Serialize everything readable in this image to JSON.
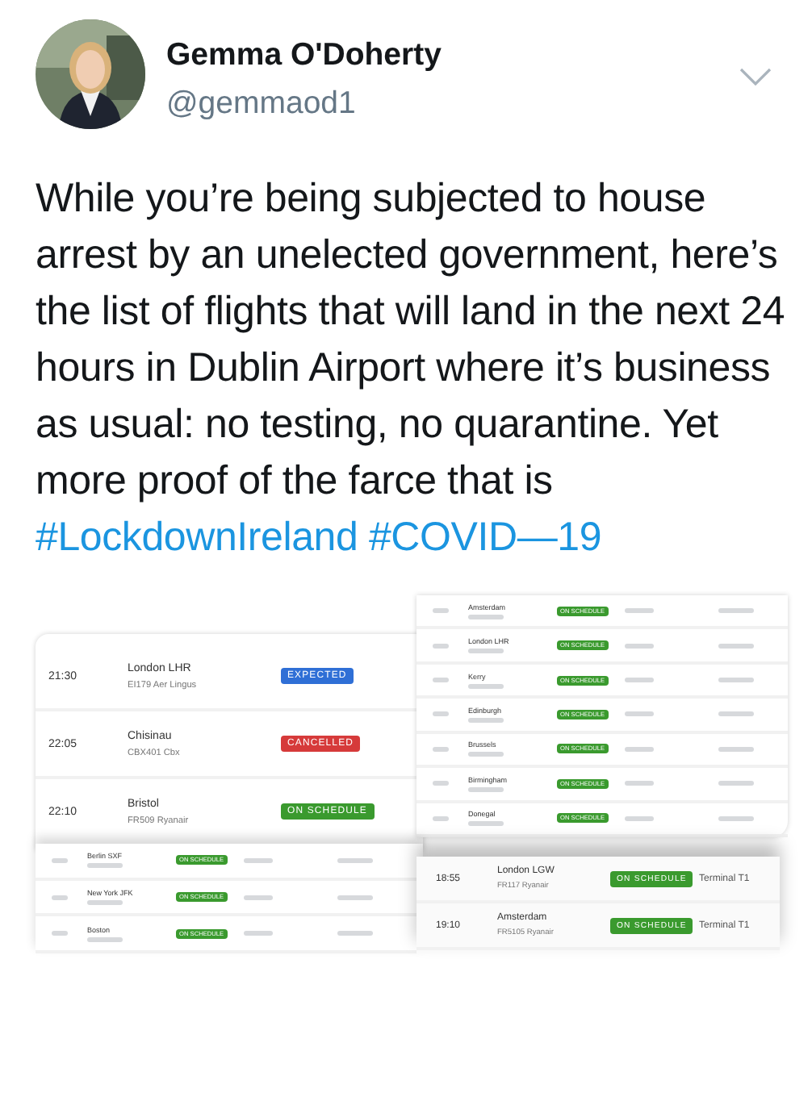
{
  "author": {
    "name": "Gemma O'Doherty",
    "handle": "@gemmaod1"
  },
  "tweet": {
    "text": "While you’re being subjected to house arrest by an unelected government, here’s the list of flights that will land in the next 24 hours in Dublin Airport where it’s business as usual:  no testing, no quarantine. Yet more proof of the farce that is ",
    "hashtags": [
      "#LockdownIreland",
      "#COVID—19"
    ]
  },
  "collage": {
    "panels": [
      {
        "kind": "large",
        "rows": [
          {
            "time": "21:30",
            "destination": "London LHR",
            "flight": "EI179 Aer Lingus",
            "status": "EXPECTED",
            "kind": "expected"
          },
          {
            "time": "22:05",
            "destination": "Chisinau",
            "flight": "CBX401 Cbx",
            "status": "CANCELLED",
            "kind": "cancelled"
          },
          {
            "time": "22:10",
            "destination": "Bristol",
            "flight": "FR509 Ryanair",
            "status": "ON SCHEDULE",
            "kind": "on_schedule"
          }
        ]
      },
      {
        "kind": "small",
        "rows": [
          {
            "destination": "Amsterdam",
            "status": "ON SCHEDULE",
            "kind": "on_schedule"
          },
          {
            "destination": "London LHR",
            "status": "ON SCHEDULE",
            "kind": "on_schedule"
          },
          {
            "destination": "Kerry",
            "status": "ON SCHEDULE",
            "kind": "on_schedule"
          },
          {
            "destination": "Edinburgh",
            "status": "ON SCHEDULE",
            "kind": "on_schedule"
          },
          {
            "destination": "Brussels",
            "status": "ON SCHEDULE",
            "kind": "on_schedule"
          },
          {
            "destination": "Birmingham",
            "status": "ON SCHEDULE",
            "kind": "on_schedule"
          },
          {
            "destination": "Donegal",
            "status": "ON SCHEDULE",
            "kind": "on_schedule"
          }
        ]
      },
      {
        "kind": "small",
        "rows": [
          {
            "destination": "Berlin SXF",
            "status": "ON SCHEDULE",
            "kind": "on_schedule"
          },
          {
            "destination": "New York JFK",
            "status": "ON SCHEDULE",
            "kind": "on_schedule"
          },
          {
            "destination": "Boston",
            "status": "ON SCHEDULE",
            "kind": "on_schedule"
          }
        ]
      },
      {
        "kind": "medium",
        "rows": [
          {
            "time": "18:55",
            "destination": "London LGW",
            "flight": "FR117 Ryanair",
            "status": "ON SCHEDULE",
            "kind": "on_schedule",
            "terminal": "Terminal T1"
          },
          {
            "time": "19:10",
            "destination": "Amsterdam",
            "flight": "FR5105 Ryanair",
            "status": "ON SCHEDULE",
            "kind": "on_schedule",
            "terminal": "Terminal T1"
          }
        ]
      }
    ]
  }
}
